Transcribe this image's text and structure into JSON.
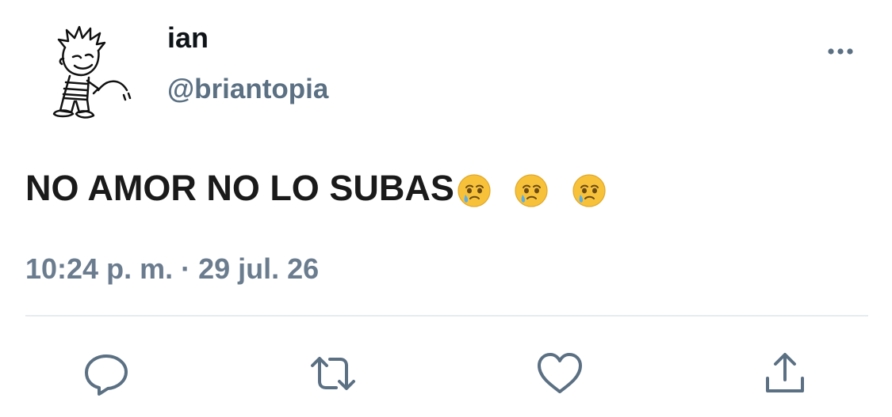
{
  "user": {
    "display_name": "ian",
    "handle": "@briantopia",
    "avatar_icon": "cartoon-boy-avatar"
  },
  "tweet": {
    "text": "NO AMOR NO LO SUBAS",
    "emojis": [
      "face-holding-back-tears",
      "face-holding-back-tears",
      "face-holding-back-tears"
    ],
    "timestamp": "10:24 p. m. · 29 jul. 26"
  },
  "actions": {
    "more_icon": "more-dots-icon",
    "reply_icon": "reply-icon",
    "retweet_icon": "retweet-icon",
    "like_icon": "like-heart-icon",
    "share_icon": "share-icon"
  },
  "colors": {
    "text_primary": "#0f1419",
    "text_secondary": "#5b7083",
    "divider": "#e6ecf0",
    "emoji_face": "#f7c23a",
    "emoji_tear": "#5aaee8"
  }
}
